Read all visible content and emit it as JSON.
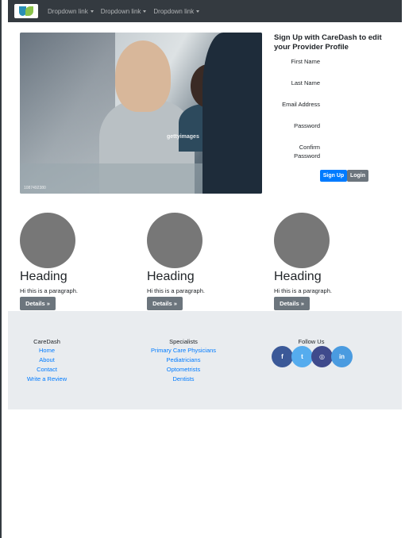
{
  "navbar": {
    "links": [
      "Dropdown link",
      "Dropdown link",
      "Dropdown link"
    ]
  },
  "hero": {
    "watermark": "gettyimages",
    "credit": "1087492380"
  },
  "signup": {
    "title": "Sign Up with CareDash to edit your Provider Profile",
    "first_name_label": "First Name",
    "last_name_label": "Last Name",
    "email_label": "Email Address",
    "password_label": "Password",
    "confirm_label_line1": "Confirm",
    "confirm_label_line2": "Password",
    "signup_button": "Sign Up",
    "login_button": "Login"
  },
  "cards": [
    {
      "heading": "Heading",
      "text": "Hi this is a paragraph.",
      "button": "Details »"
    },
    {
      "heading": "Heading",
      "text": "Hi this is a paragraph.",
      "button": "Details »"
    },
    {
      "heading": "Heading",
      "text": "Hi this is a paragraph.",
      "button": "Details »"
    }
  ],
  "footer": {
    "col1_title": "CareDash",
    "col1_links": [
      "Home",
      "About",
      "Contact",
      "Write a Review"
    ],
    "col2_title": "Specialists",
    "col2_links": [
      "Primary Care Physicians",
      "Pediatricians",
      "Optometrists",
      "Dentists"
    ],
    "col3_title": "Follow Us",
    "social": [
      {
        "icon": "facebook-icon",
        "glyph": "f",
        "color": "#3b5998"
      },
      {
        "icon": "twitter-icon",
        "glyph": "t",
        "color": "#55acee"
      },
      {
        "icon": "instagram-icon",
        "glyph": "◎",
        "color": "#3f4a8c"
      },
      {
        "icon": "linkedin-icon",
        "glyph": "in",
        "color": "#4a9be0"
      }
    ]
  },
  "colors": {
    "navbar": "#343a40",
    "primary": "#007bff",
    "secondary": "#6c757d",
    "footer_bg": "#e9ecef",
    "placeholder_circle": "#777777"
  }
}
